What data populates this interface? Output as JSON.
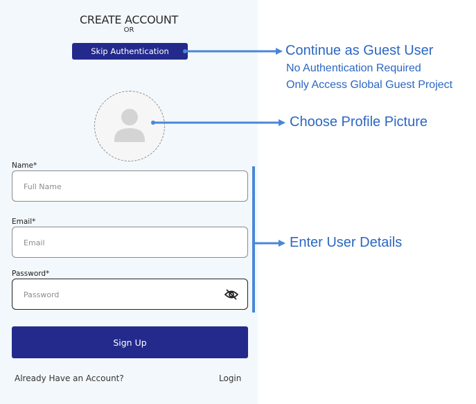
{
  "header": {
    "title": "CREATE ACCOUNT",
    "or_text": "OR"
  },
  "skip_button": {
    "label": "Skip Authentication"
  },
  "avatar": {
    "icon": "user-silhouette-icon"
  },
  "form": {
    "name": {
      "label": "Name*",
      "placeholder": "Full Name"
    },
    "email": {
      "label": "Email*",
      "placeholder": "Email"
    },
    "password": {
      "label": "Password*",
      "placeholder": "Password",
      "toggle_icon": "eye-off-icon"
    }
  },
  "signup_button": {
    "label": "Sign Up"
  },
  "footer": {
    "already_text": "Already Have an Account?",
    "login_label": "Login"
  },
  "annotations": {
    "guest": {
      "title": "Continue as Guest User",
      "line1": "No Authentication Required",
      "line2": "Only Access Global Guest Project"
    },
    "profile": {
      "title": "Choose Profile Picture"
    },
    "details": {
      "title": "Enter User Details"
    }
  },
  "colors": {
    "primary": "#232a8c",
    "annotation": "#2b66c2",
    "arrow": "#4a86d8",
    "panel_bg": "#f3f8fc"
  }
}
